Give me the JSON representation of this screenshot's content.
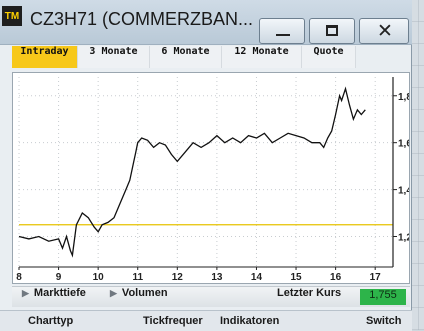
{
  "window": {
    "logo_text": "TM",
    "title": "CZ3H71 (COMMERZBAN...",
    "buttons": {
      "minimize": "minimize",
      "maximize": "maximize",
      "close": "✕"
    }
  },
  "tabs": [
    {
      "label": "Intraday",
      "active": true
    },
    {
      "label": "3 Monate",
      "active": false
    },
    {
      "label": "6 Monate",
      "active": false
    },
    {
      "label": "12 Monate",
      "active": false
    },
    {
      "label": "Quote",
      "active": false
    }
  ],
  "chart_data": {
    "type": "line",
    "title": "",
    "xlabel": "",
    "ylabel": "",
    "x_ticks": [
      "8",
      "9",
      "10",
      "11",
      "12",
      "13",
      "14",
      "15",
      "16",
      "17"
    ],
    "y_ticks": [
      "1,8",
      "1,6",
      "1,4",
      "1,2"
    ],
    "y_tick_values": [
      1.8,
      1.6,
      1.4,
      1.2
    ],
    "xlim": [
      8,
      17.45
    ],
    "ylim": [
      1.07,
      1.88
    ],
    "reference_line": {
      "value": 1.25,
      "color": "#e6c200"
    },
    "series": [
      {
        "color": "#111111",
        "x": [
          8.0,
          8.25,
          8.5,
          8.75,
          9.0,
          9.1,
          9.2,
          9.3,
          9.35,
          9.45,
          9.6,
          9.75,
          9.9,
          10.0,
          10.1,
          10.25,
          10.4,
          10.55,
          10.7,
          10.8,
          10.9,
          10.95,
          11.0,
          11.1,
          11.25,
          11.4,
          11.55,
          11.7,
          11.85,
          12.0,
          12.2,
          12.4,
          12.6,
          12.8,
          13.0,
          13.2,
          13.4,
          13.6,
          13.8,
          14.0,
          14.2,
          14.4,
          14.6,
          14.8,
          15.0,
          15.2,
          15.4,
          15.6,
          15.7,
          15.8,
          15.9,
          16.0,
          16.1,
          16.15,
          16.25,
          16.35,
          16.45,
          16.55,
          16.65,
          16.75
        ],
        "y": [
          1.2,
          1.19,
          1.2,
          1.18,
          1.19,
          1.15,
          1.2,
          1.14,
          1.12,
          1.25,
          1.3,
          1.28,
          1.24,
          1.22,
          1.25,
          1.26,
          1.28,
          1.34,
          1.4,
          1.44,
          1.52,
          1.56,
          1.6,
          1.62,
          1.61,
          1.58,
          1.6,
          1.59,
          1.55,
          1.52,
          1.56,
          1.6,
          1.58,
          1.6,
          1.63,
          1.6,
          1.62,
          1.6,
          1.63,
          1.62,
          1.64,
          1.6,
          1.62,
          1.64,
          1.63,
          1.62,
          1.6,
          1.6,
          1.58,
          1.62,
          1.65,
          1.72,
          1.8,
          1.78,
          1.83,
          1.76,
          1.7,
          1.74,
          1.72,
          1.74
        ]
      }
    ]
  },
  "statusbar": {
    "markttiefe": "Markttiefe",
    "volumen": "Volumen",
    "letzter_kurs_label": "Letzter Kurs",
    "letzter_kurs_value": "1,755",
    "arrow_glyph": "▶"
  },
  "footer": {
    "charttyp": "Charttyp",
    "tickfrequenz": "Tickfrequer",
    "indikatoren": "Indikatoren",
    "switch": "Switch"
  }
}
